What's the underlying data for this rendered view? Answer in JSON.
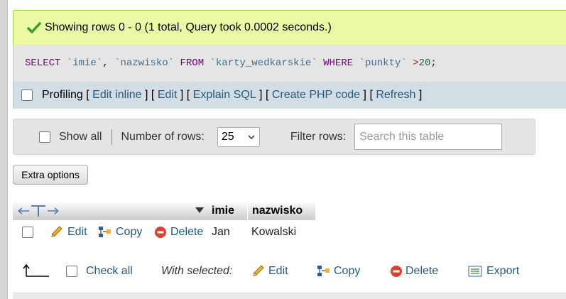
{
  "success": {
    "message": "Showing rows 0 - 0 (1 total, Query took 0.0002 seconds.)"
  },
  "sql": {
    "kw_select": "SELECT",
    "col1": "`imie`",
    "comma": ",",
    "col2": "`nazwisko`",
    "kw_from": "FROM",
    "table": "`karty_wedkarskie`",
    "kw_where": "WHERE",
    "col3": "`punkty`",
    "op": ">",
    "num": "20",
    "semi": ";"
  },
  "links": {
    "profiling": "Profiling",
    "edit_inline": "Edit inline",
    "edit": "Edit",
    "explain_sql": "Explain SQL",
    "create_php": "Create PHP code",
    "refresh": "Refresh",
    "open": "[",
    "close": "]"
  },
  "nav": {
    "show_all": "Show all",
    "rows_label": "Number of rows:",
    "rows_value": "25",
    "filter_label": "Filter rows:",
    "filter_placeholder": "Search this table"
  },
  "extra_options": "Extra options",
  "table": {
    "columns": [
      "imie",
      "nazwisko"
    ],
    "rows": [
      {
        "imie": "Jan",
        "nazwisko": "Kowalski"
      }
    ],
    "row_actions": {
      "edit": "Edit",
      "copy": "Copy",
      "delete": "Delete"
    }
  },
  "bottom": {
    "check_all": "Check all",
    "with_selected": "With selected:",
    "edit": "Edit",
    "copy": "Copy",
    "delete": "Delete",
    "export": "Export"
  },
  "colors": {
    "success_bg": "#ebf8a4",
    "link": "#235a81",
    "sql_keyword": "#770088",
    "sql_backtick": "#3e6e92"
  }
}
